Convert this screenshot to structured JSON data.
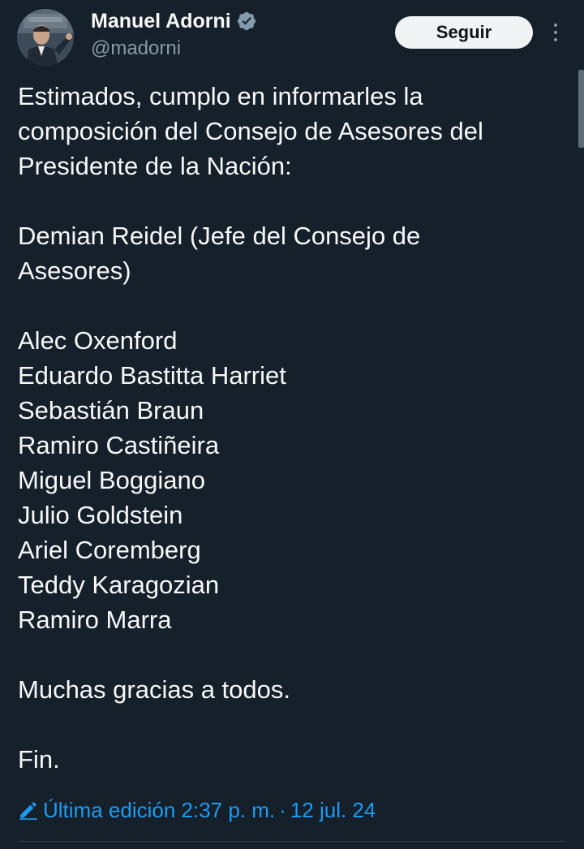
{
  "author": {
    "name": "Manuel Adorni",
    "handle": "@madorni",
    "verified": true
  },
  "follow_button": {
    "label": "Seguir"
  },
  "tweet": {
    "lines": [
      "Estimados, cumplo en informarles la",
      "composición del Consejo de Asesores del",
      "Presidente de la Nación:",
      "",
      "Demian Reidel (Jefe del Consejo de",
      "Asesores)",
      "",
      "Alec Oxenford",
      "Eduardo Bastitta Harriet",
      "Sebastián Braun",
      "Ramiro Castiñeira",
      "Miguel Boggiano",
      "Julio Goldstein",
      "Ariel Coremberg",
      "Teddy Karagozian",
      "Ramiro Marra",
      "",
      "Muchas gracias a todos.",
      "",
      "Fin."
    ]
  },
  "edit_info": {
    "label": "Última edición 2:37 p. m.",
    "separator": "·",
    "date": "12 jul. 24"
  },
  "icons": {
    "verified": "verified-badge-icon",
    "more": "more-options-icon",
    "edit": "pencil-edit-icon"
  },
  "colors": {
    "background": "#15202b",
    "text": "#f7f9f9",
    "secondary_text": "#8b98a5",
    "accent": "#1d9bf0",
    "button_bg": "#eff3f4"
  }
}
